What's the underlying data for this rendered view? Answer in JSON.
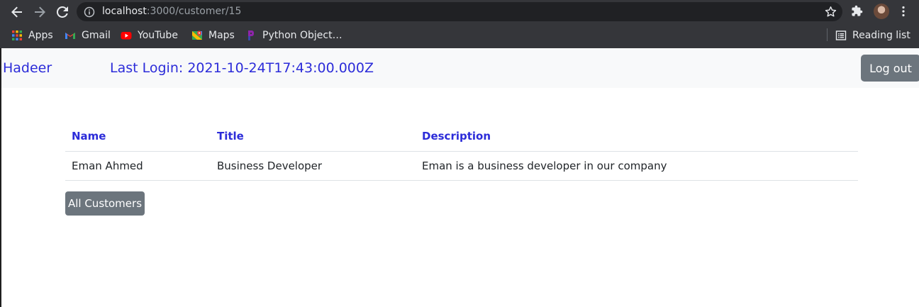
{
  "browser": {
    "url_host": "localhost",
    "url_path": ":3000/customer/15",
    "bookmarks": [
      {
        "label": "Apps",
        "icon": "apps-grid-icon"
      },
      {
        "label": "Gmail",
        "icon": "gmail-icon"
      },
      {
        "label": "YouTube",
        "icon": "youtube-icon"
      },
      {
        "label": "Maps",
        "icon": "maps-icon"
      },
      {
        "label": "Python Object…",
        "icon": "python-bookmark-icon"
      }
    ],
    "reading_list_label": "Reading list"
  },
  "navbar": {
    "brand": "Hadeer",
    "last_login": "Last Login: 2021-10-24T17:43:00.000Z",
    "logout_label": "Log out"
  },
  "table": {
    "headers": [
      "Name",
      "Title",
      "Description"
    ],
    "rows": [
      [
        "Eman Ahmed",
        "Business Developer",
        "Eman is a business developer in our company"
      ]
    ]
  },
  "all_customers_label": "All Customers",
  "colors": {
    "link_blue": "#2c2cd9",
    "button_gray": "#6c757d",
    "navbar_bg": "#f8f9fa",
    "chrome_bg": "#35363a"
  }
}
